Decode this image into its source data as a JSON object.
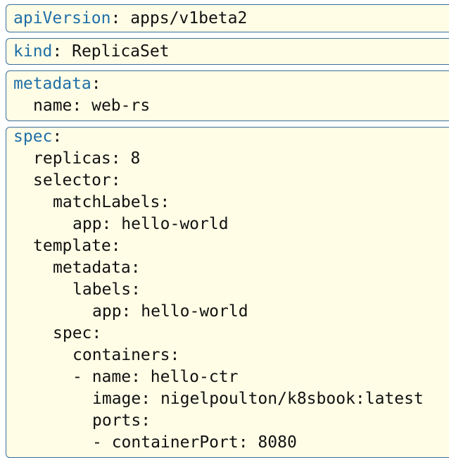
{
  "blocks": {
    "api_version": {
      "key": "apiVersion",
      "value": "apps/v1beta2"
    },
    "kind": {
      "key": "kind",
      "value": "ReplicaSet"
    },
    "metadata": {
      "key": "metadata",
      "name_key": "name",
      "name_value": "web-rs"
    },
    "spec": {
      "key": "spec",
      "lines": [
        {
          "key": "replicas",
          "value": "8"
        },
        {
          "key": "selector",
          "value": ""
        },
        {
          "key": "matchLabels",
          "value": ""
        },
        {
          "key": "app",
          "value": "hello-world"
        },
        {
          "key": "template",
          "value": ""
        },
        {
          "key": "metadata",
          "value": ""
        },
        {
          "key": "labels",
          "value": ""
        },
        {
          "key": "app",
          "value": "hello-world"
        },
        {
          "key": "spec",
          "value": ""
        },
        {
          "key": "containers",
          "value": ""
        },
        {
          "key": "- name",
          "value": "hello-ctr"
        },
        {
          "key": "image",
          "value": "nigelpoulton/k8sbook:latest"
        },
        {
          "key": "ports",
          "value": ""
        },
        {
          "key": "- containerPort",
          "value": "8080"
        }
      ]
    }
  },
  "colors": {
    "block_background": "#fffde6",
    "block_border": "#3a6d9a",
    "top_key": "#1f6fa8",
    "text": "#111111"
  }
}
